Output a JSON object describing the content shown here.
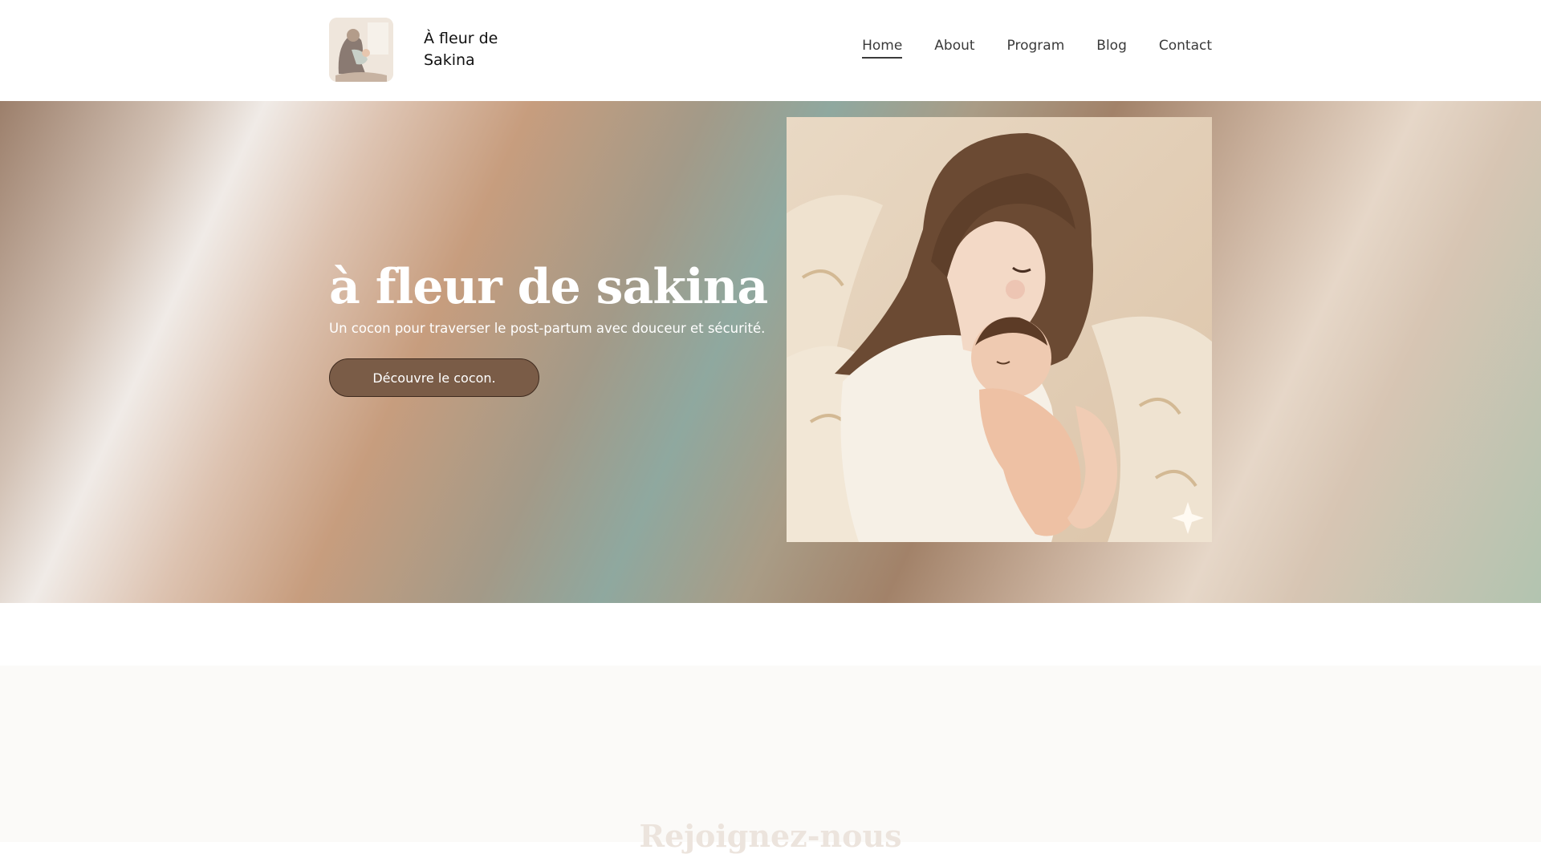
{
  "header": {
    "brand_name": "À fleur de Sakina",
    "nav": [
      {
        "label": "Home",
        "active": true
      },
      {
        "label": "About",
        "active": false
      },
      {
        "label": "Program",
        "active": false
      },
      {
        "label": "Blog",
        "active": false
      },
      {
        "label": "Contact",
        "active": false
      }
    ]
  },
  "hero": {
    "title": "à fleur de sakina",
    "subtitle": "Un cocon pour traverser le post-partum avec douceur et sécurité.",
    "cta_label": "Découvre le cocon."
  },
  "section": {
    "heading": "Rejoignez-nous"
  },
  "colors": {
    "cta_background": "#7a5c47",
    "text_dark": "#111111",
    "nav_text": "#3a3a3a"
  }
}
